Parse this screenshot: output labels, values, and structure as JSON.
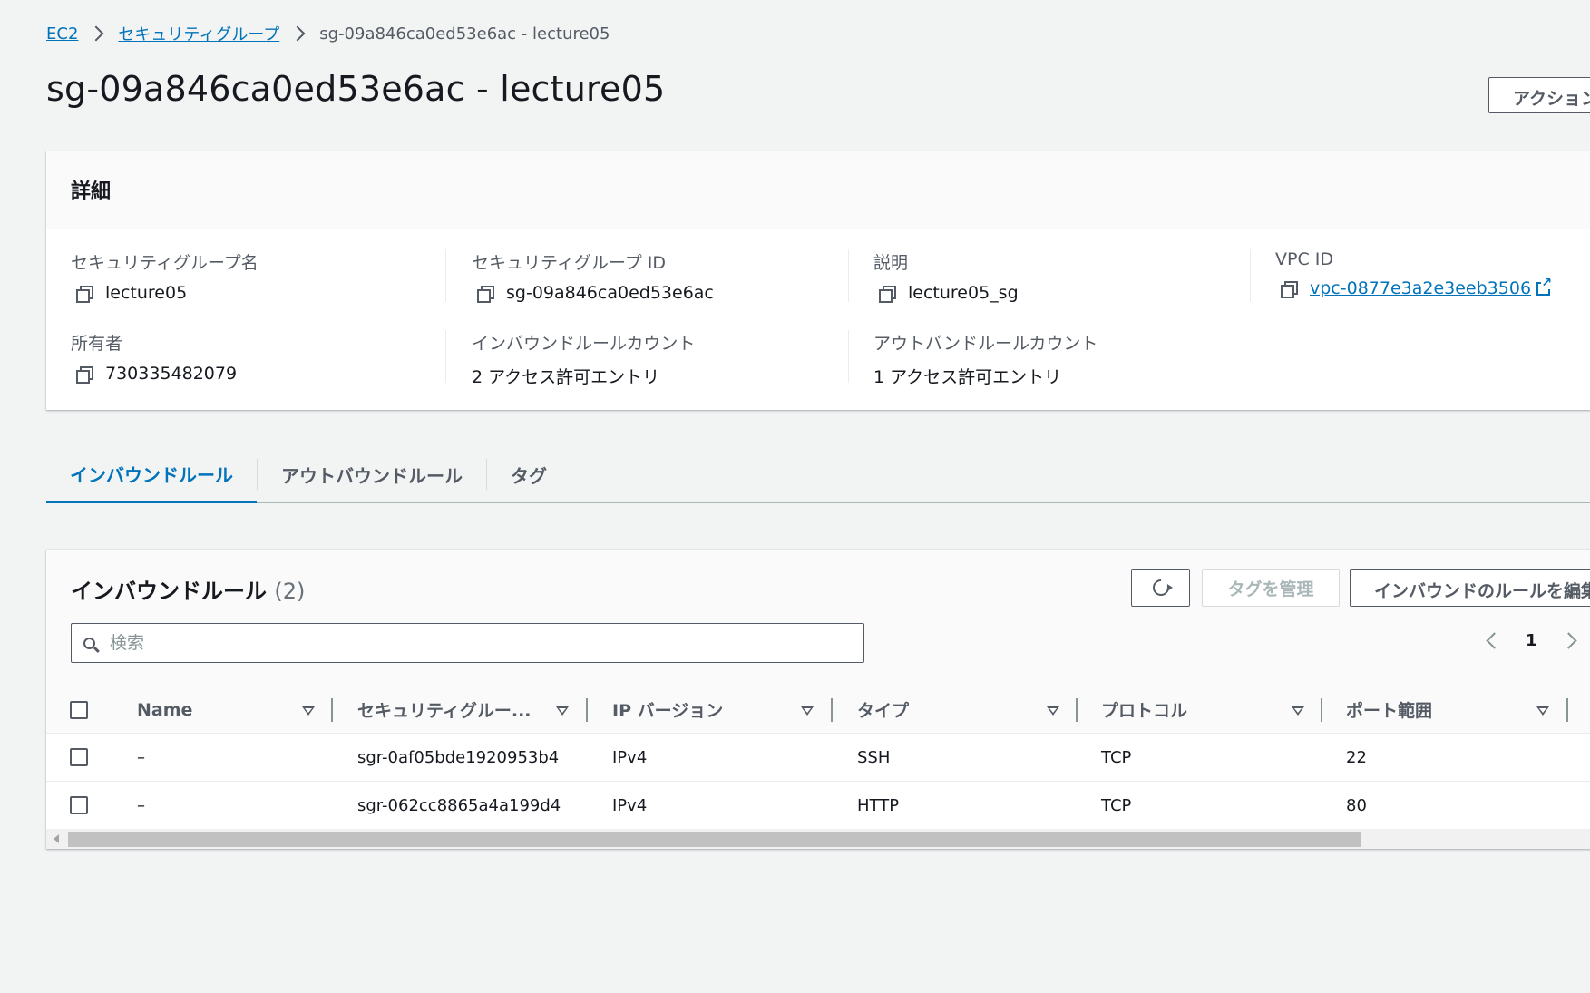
{
  "breadcrumb": {
    "items": [
      "EC2",
      "セキュリティグループ"
    ],
    "current": "sg-09a846ca0ed53e6ac - lecture05"
  },
  "page": {
    "title": "sg-09a846ca0ed53e6ac - lecture05",
    "actions_label": "アクション"
  },
  "details": {
    "header": "詳細",
    "fields": {
      "sg_name": {
        "label": "セキュリティグループ名",
        "value": "lecture05"
      },
      "sg_id": {
        "label": "セキュリティグループ ID",
        "value": "sg-09a846ca0ed53e6ac"
      },
      "description": {
        "label": "説明",
        "value": "lecture05_sg"
      },
      "vpc_id": {
        "label": "VPC ID",
        "value": "vpc-0877e3a2e3eeb3506"
      },
      "owner": {
        "label": "所有者",
        "value": "730335482079"
      },
      "inbound_count": {
        "label": "インバウンドルールカウント",
        "value": "2 アクセス許可エントリ"
      },
      "outbound_count": {
        "label": "アウトバンドルールカウント",
        "value": "1 アクセス許可エントリ"
      }
    }
  },
  "tabs": [
    {
      "label": "インバウンドルール",
      "active": true
    },
    {
      "label": "アウトバウンドルール",
      "active": false
    },
    {
      "label": "タグ",
      "active": false
    }
  ],
  "rules": {
    "title": "インバウンドルール",
    "count": "(2)",
    "manage_tags_label": "タグを管理",
    "edit_label": "インバウンドのルールを編集",
    "search_placeholder": "検索",
    "page": "1",
    "columns": [
      "Name",
      "セキュリティグルー...",
      "IP バージョン",
      "タイプ",
      "プロトコル",
      "ポート範囲"
    ],
    "rows": [
      [
        "–",
        "sgr-0af05bde1920953b4",
        "IPv4",
        "SSH",
        "TCP",
        "22"
      ],
      [
        "–",
        "sgr-062cc8865a4a199d4",
        "IPv4",
        "HTTP",
        "TCP",
        "80"
      ]
    ]
  },
  "colors": {
    "link": "#0073bb",
    "text": "#16191f",
    "muted": "#545b64",
    "background": "#f2f3f3"
  }
}
